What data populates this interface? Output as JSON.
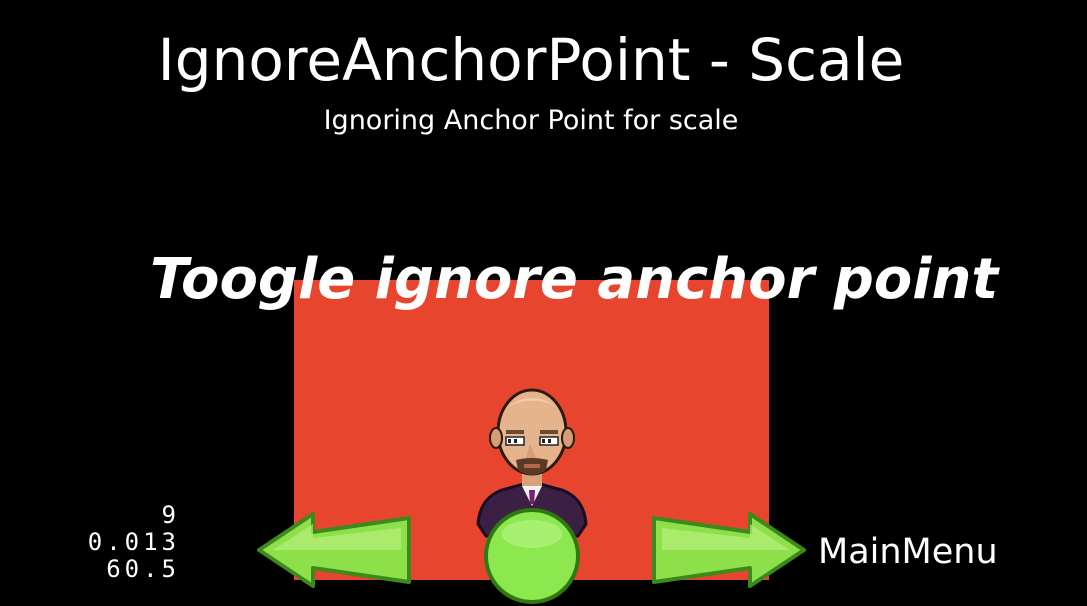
{
  "header": {
    "title": "IgnoreAnchorPoint - Scale",
    "subtitle": "Ignoring Anchor Point for scale"
  },
  "scene": {
    "toggle_label": "Toogle ignore anchor point",
    "layer_color": "#e8452f",
    "sprite_icon": "grossini-character-icon"
  },
  "controls": {
    "back_icon": "green-arrow-left-icon",
    "restart_icon": "green-ball-icon",
    "next_icon": "green-arrow-right-icon",
    "main_menu_label": "MainMenu"
  },
  "stats": {
    "draw_calls": "9",
    "frame_time": "0.013",
    "fps": "60.5"
  }
}
